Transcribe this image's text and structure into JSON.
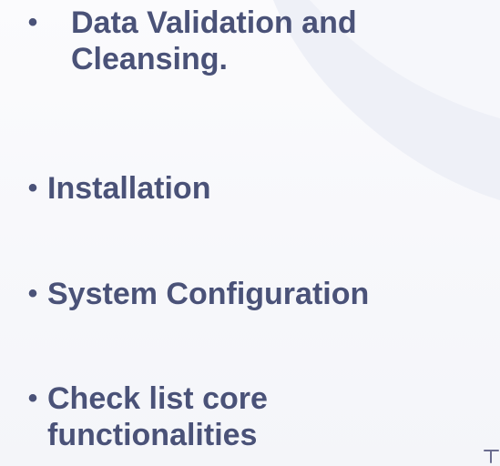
{
  "bullets": [
    {
      "marker": "•",
      "text": "Data Validation and\nCleansing."
    },
    {
      "marker": "•",
      "text": "Installation"
    },
    {
      "marker": "•",
      "text": "System Configuration"
    },
    {
      "marker": "•",
      "text": "Check list core\nfunctionalities"
    }
  ],
  "colors": {
    "text": "#4a5278",
    "background_top": "#fbfbfd",
    "background_bottom": "#f4f5f9",
    "accent_shape": "#e6e8f2",
    "corner_mark": "#6a6c8f"
  }
}
